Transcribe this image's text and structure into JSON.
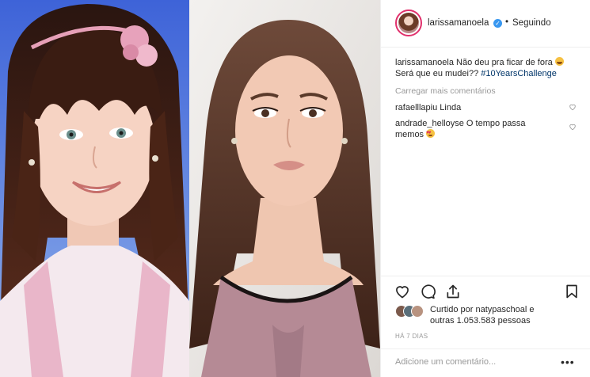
{
  "post": {
    "username": "larissamanoela",
    "verified_icon": "verified-badge-icon",
    "separator": "•",
    "follow_status": "Seguindo",
    "caption": {
      "username": "larissamanoela",
      "text": "Não deu pra ficar de fora",
      "text2": "Será que eu mudei??",
      "hashtag": "#10YearsChallenge"
    },
    "load_more": "Carregar mais comentários",
    "comments": [
      {
        "username": "rafaelllapiu",
        "text": "Linda"
      },
      {
        "username": "andrade_helloyse",
        "text": "O tempo passa memos"
      }
    ],
    "likes": {
      "prefix": "Curtido por",
      "user": "natypaschoal",
      "conj": "e",
      "others": "outras 1.053.583 pessoas"
    },
    "timestamp": "HÁ 7 DIAS",
    "add_comment_placeholder": "Adicione um comentário...",
    "more_label": "•••"
  },
  "icons": {
    "like": "heart-outline-icon",
    "comment": "speech-bubble-icon",
    "share": "share-icon",
    "save": "bookmark-icon"
  },
  "colors": {
    "hashtag": "#003569",
    "muted": "#999999",
    "text": "#262626",
    "verified": "#3897f0",
    "border": "#efefef"
  }
}
